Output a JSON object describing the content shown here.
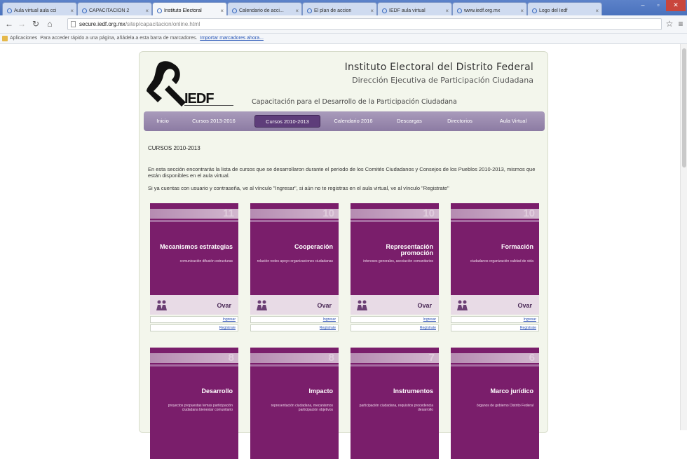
{
  "browser": {
    "tabs": [
      {
        "label": "Aula virtual aula cci",
        "active": false
      },
      {
        "label": "CAPACITACION 2",
        "active": false
      },
      {
        "label": "Instituto Electoral",
        "active": true
      },
      {
        "label": "Calendario de acci...",
        "active": false
      },
      {
        "label": "El plan de accion",
        "active": false
      },
      {
        "label": "IEDF aula virtual",
        "active": false
      },
      {
        "label": "www.iedf.org.mx",
        "active": false
      },
      {
        "label": "Logo del Iedf",
        "active": false
      }
    ],
    "url_host": "secure.iedf.org.mx",
    "url_path": "/sitep/capacitacion/online.html",
    "bookmarks_prefix": "Aplicaciones",
    "bookmarks_text": "Para acceder rápido a una página, añádela a esta barra de marcadores.",
    "bookmarks_link": "Importar marcadores ahora..."
  },
  "site": {
    "logo_text": "IEDF",
    "title": "Instituto Electoral del Distrito Federal",
    "subtitle": "Dirección Ejecutiva de Participación Ciudadana",
    "tagline": "Capacitación para el Desarrollo de la Participación Ciudadana",
    "menu": [
      {
        "label": "Inicio",
        "active": false
      },
      {
        "label": "Cursos 2013-2016",
        "active": false
      },
      {
        "label": "Cursos 2010-2013",
        "active": true
      },
      {
        "label": "Calendario 2016",
        "active": false
      },
      {
        "label": "Descargas",
        "active": false
      },
      {
        "label": "Directorios",
        "active": false
      },
      {
        "label": "Aula Virtual",
        "active": false
      }
    ],
    "section_title": "CURSOS 2010-2013",
    "intro": "En esta sección encontrarás la lista de cursos que se desarrollaron durante el periodo de los Comités Ciudadanos y Consejos de los Pueblos 2010-2013, mismos que están disponibles en el aula virtual.",
    "intro2": "Si ya cuentas con usuario y contraseña, ve al vínculo \"Ingresar\", si aún no te registras en el aula virtual, ve al vínculo \"Registrate\"",
    "link_enter": "Ingresar",
    "link_register": "Regístrate",
    "brand": "Ovar",
    "courses": [
      {
        "num": "11",
        "title": "Mecanismos estrategias",
        "sub": "comunicación difusión estructuras"
      },
      {
        "num": "10",
        "title": "Cooperación",
        "sub": "relación redes apoyo organizaciones ciudadanas"
      },
      {
        "num": "10",
        "title": "Representación promoción",
        "sub": "intereses generales, asociación comunitarios"
      },
      {
        "num": "10",
        "title": "Formación",
        "sub": "ciudadanos organización calidad de vida"
      },
      {
        "num": "8",
        "title": "Desarrollo",
        "sub": "proyectos propuestas temas participación ciudadana bienestar comunitario"
      },
      {
        "num": "8",
        "title": "Impacto",
        "sub": "representación ciudadana, mecanismos participación objetivos"
      },
      {
        "num": "7",
        "title": "Instrumentos",
        "sub": "participación ciudadana, requisitos procedencia desarrollo"
      },
      {
        "num": "6",
        "title": "Marco jurídico",
        "sub": "órganos de gobierno Distrito Federal"
      }
    ]
  },
  "colors": {
    "menu_bg": "#9a8aae",
    "menu_active": "#5e3d7a",
    "card_purple": "#7a1e6b",
    "page_bg": "#f3f6ec"
  }
}
